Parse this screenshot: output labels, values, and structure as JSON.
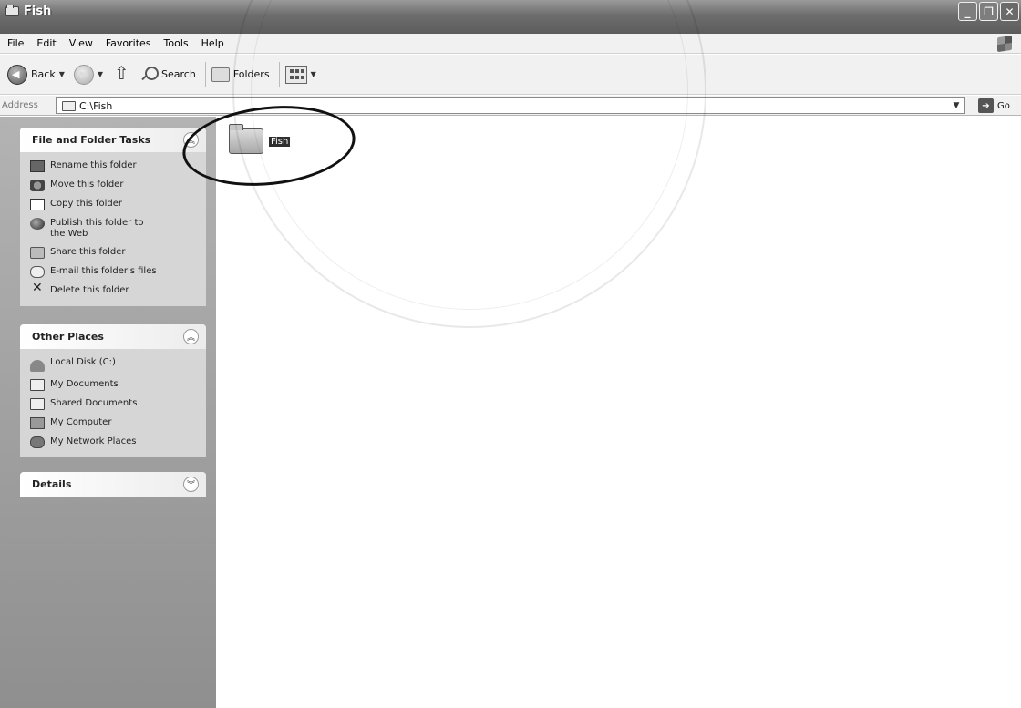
{
  "window": {
    "title": "Fish",
    "controls": [
      "minimize",
      "maximize",
      "close"
    ]
  },
  "menubar": {
    "items": [
      "File",
      "Edit",
      "View",
      "Favorites",
      "Tools",
      "Help"
    ]
  },
  "toolbar": {
    "back_label": "Back",
    "search_label": "Search",
    "folders_label": "Folders"
  },
  "address": {
    "label": "Address",
    "value": "C:\\Fish",
    "go_label": "Go"
  },
  "tasks_panel": {
    "title": "File and Folder Tasks",
    "items": [
      {
        "label": "Rename this folder",
        "icon": "rename-icon"
      },
      {
        "label": "Move this folder",
        "icon": "move-icon"
      },
      {
        "label": "Copy this folder",
        "icon": "copy-icon"
      },
      {
        "label": "Publish this folder to the Web",
        "icon": "globe-icon"
      },
      {
        "label": "Share this folder",
        "icon": "share-icon"
      },
      {
        "label": "E-mail this folder's files",
        "icon": "mail-icon"
      },
      {
        "label": "Delete this folder",
        "icon": "delete-icon"
      }
    ]
  },
  "places_panel": {
    "title": "Other Places",
    "items": [
      {
        "label": "Local Disk (C:)",
        "icon": "disk-icon"
      },
      {
        "label": "My Documents",
        "icon": "documents-icon"
      },
      {
        "label": "Shared Documents",
        "icon": "shared-documents-icon"
      },
      {
        "label": "My Computer",
        "icon": "computer-icon"
      },
      {
        "label": "My Network Places",
        "icon": "network-icon"
      }
    ]
  },
  "details_panel": {
    "title": "Details"
  },
  "content": {
    "items": [
      {
        "label": "Fish",
        "selected": true
      }
    ]
  },
  "colors": {
    "titlebar": "#6d6d6d",
    "selection": "#2e2e2e",
    "sidebar": "#a3a3a3"
  }
}
